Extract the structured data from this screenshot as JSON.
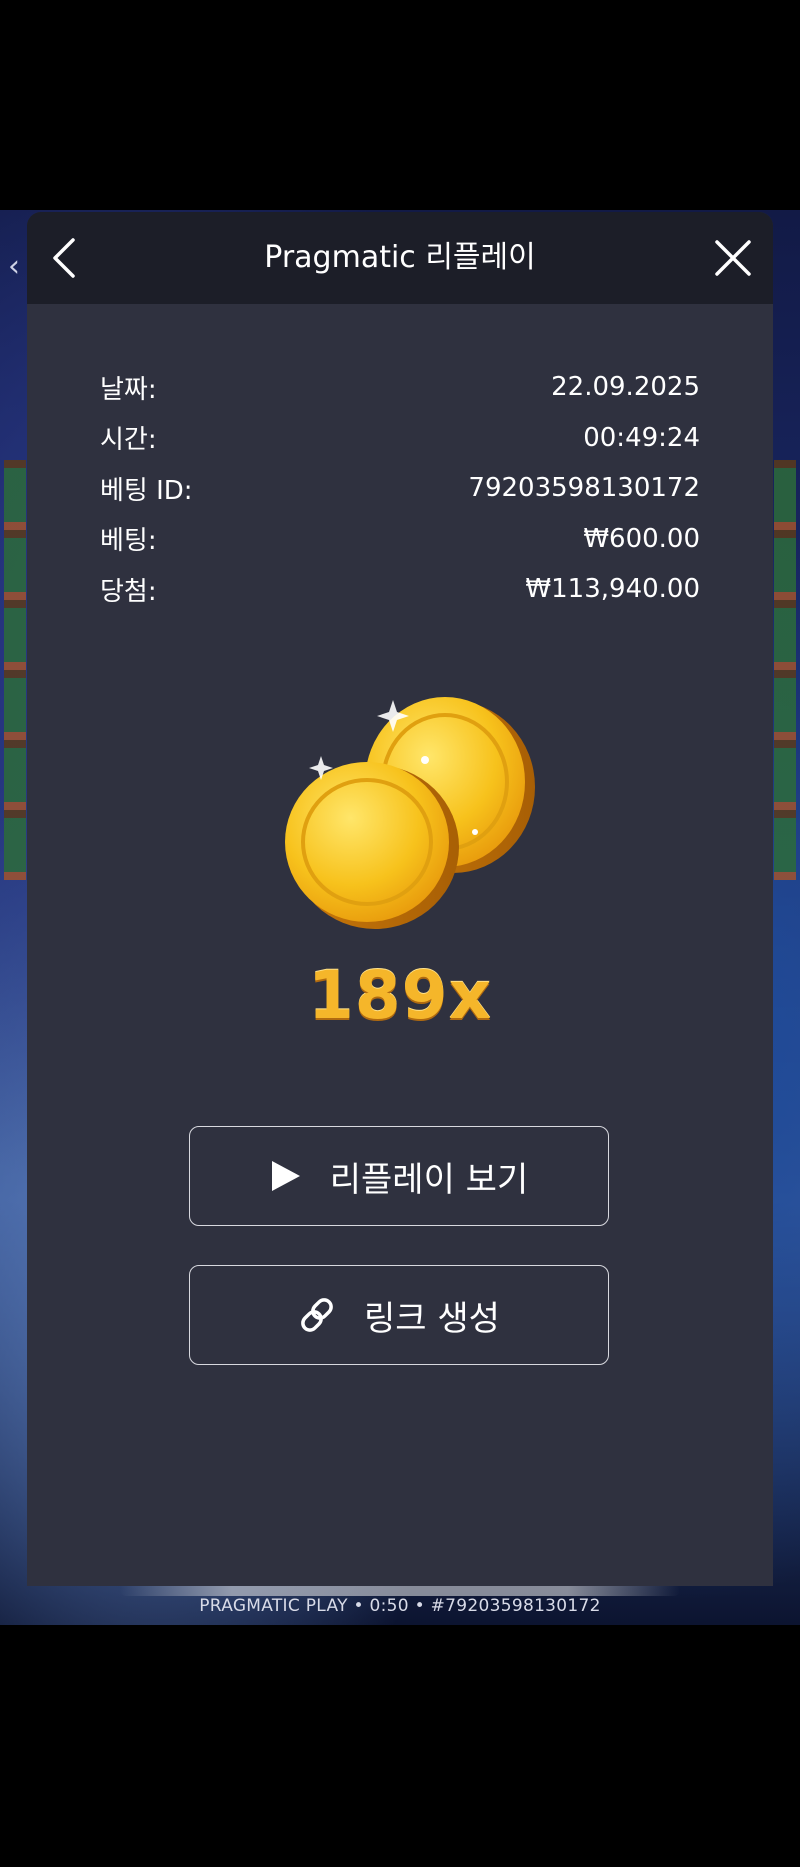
{
  "background": {
    "footer_text": "PRAGMATIC PLAY • 0:50 • #79203598130172"
  },
  "header": {
    "title": "Pragmatic 리플레이",
    "back_icon": "chevron-left-icon",
    "close_icon": "close-icon"
  },
  "details": {
    "date_label": "날짜:",
    "date_value": "22.09.2025",
    "time_label": "시간:",
    "time_value": "00:49:24",
    "bet_id_label": "베팅 ID:",
    "bet_id_value": "79203598130172",
    "bet_label": "베팅:",
    "bet_value": "₩600.00",
    "win_label": "당첨:",
    "win_value": "₩113,940.00"
  },
  "result": {
    "multiplier": "189x",
    "icon": "gold-coins-icon"
  },
  "actions": {
    "replay_label": "리플레이 보기",
    "replay_icon": "play-icon",
    "link_label": "링크 생성",
    "link_icon": "link-icon"
  },
  "colors": {
    "modal_bg": "#2f313f",
    "header_bg": "#1c1e28",
    "accent_gold": "#f5b62a"
  }
}
